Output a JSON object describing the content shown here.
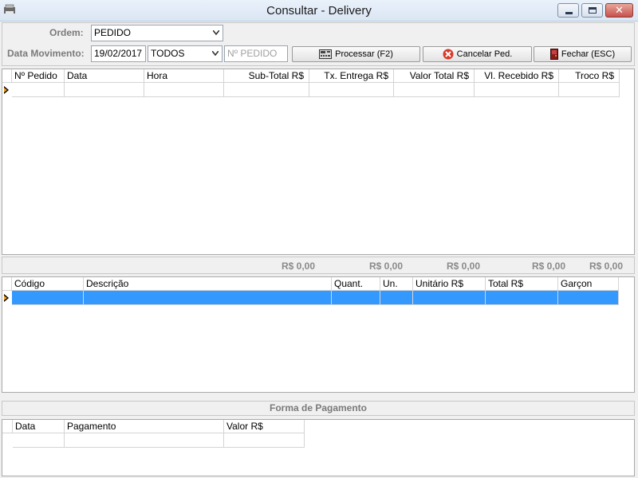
{
  "window": {
    "title": "Consultar - Delivery",
    "icons": {
      "app": "app-icon",
      "minimize": "minimize-icon",
      "maximize": "maximize-icon",
      "close": "close-icon"
    }
  },
  "filters": {
    "ordem_label": "Ordem:",
    "ordem_value": "PEDIDO",
    "data_label": "Data Movimento:",
    "data_value": "19/02/2017",
    "tipo_value": "TODOS",
    "pedido_placeholder": "Nº PEDIDO"
  },
  "toolbar": {
    "processar_label": "Processar (F2)",
    "cancelar_label": "Cancelar Ped.",
    "fechar_label": "Fechar (ESC)"
  },
  "orders_grid": {
    "columns": [
      "Nº Pedido",
      "Data",
      "Hora",
      "Sub-Total R$",
      "Tx. Entrega R$",
      "Valor Total R$",
      "Vl. Recebido R$",
      "Troco R$"
    ]
  },
  "totals": {
    "subtotal": "R$ 0,00",
    "tx_entrega": "R$ 0,00",
    "valor_total": "R$ 0,00",
    "vl_recebido": "R$ 0,00",
    "troco": "R$ 0,00"
  },
  "items_grid": {
    "columns": [
      "Código",
      "Descrição",
      "Quant.",
      "Un.",
      "Unitário R$",
      "Total R$",
      "Garçon"
    ]
  },
  "payment": {
    "title": "Forma de Pagamento",
    "columns": [
      "Data",
      "Pagamento",
      "Valor R$"
    ]
  },
  "colors": {
    "selection": "#3399ff",
    "close_button": "#c75050",
    "label_gray": "#7a7a7a",
    "cancel_icon": "#d63a2a"
  }
}
